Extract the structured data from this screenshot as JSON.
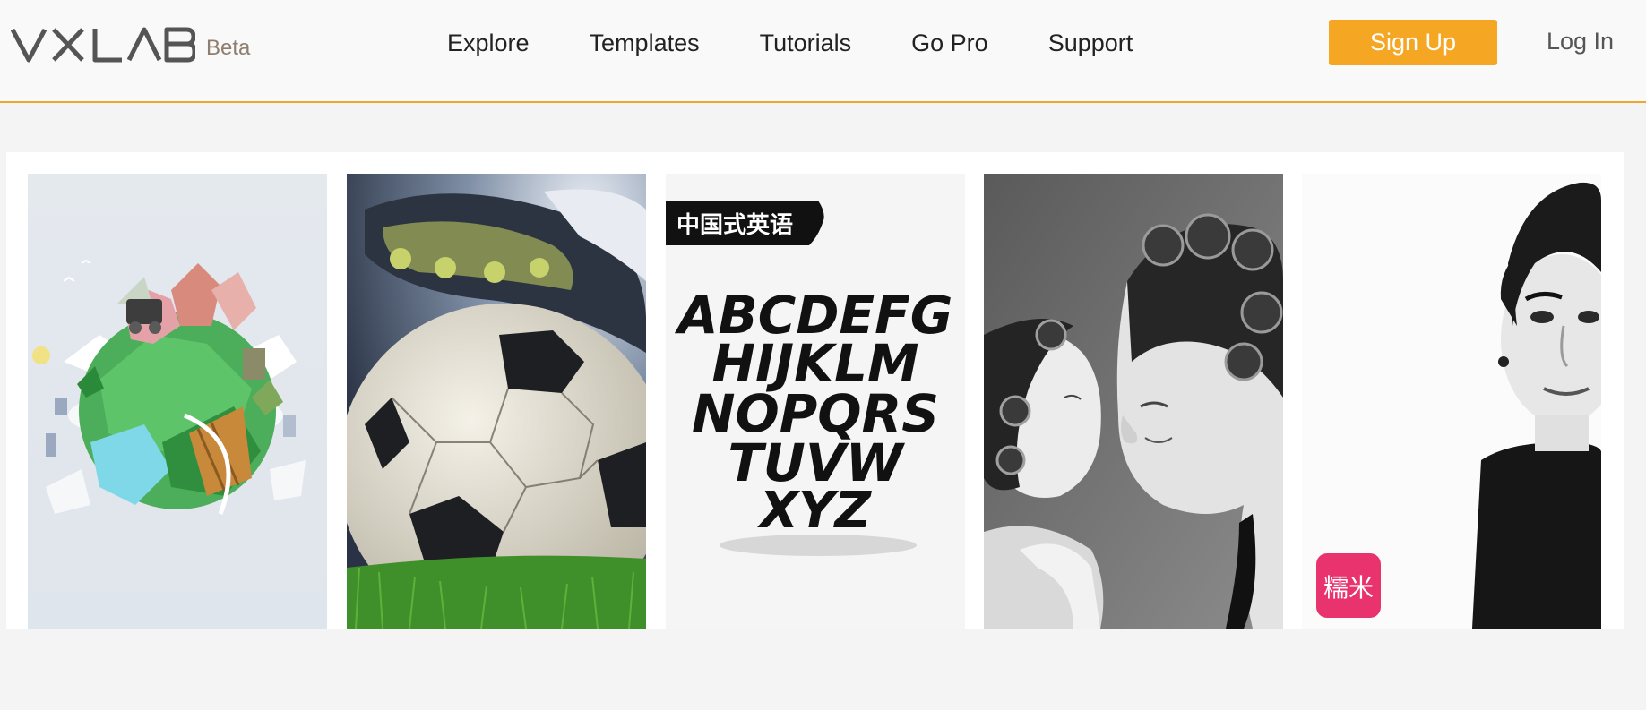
{
  "header": {
    "logo_text": "VXLAB",
    "beta_label": "Beta",
    "nav": [
      "Explore",
      "Templates",
      "Tutorials",
      "Go Pro",
      "Support"
    ],
    "signup_label": "Sign Up",
    "login_label": "Log In"
  },
  "colors": {
    "accent": "#f5a623",
    "header_border": "#f0a52b",
    "logo": "#555555",
    "beta": "#8e7e6e"
  },
  "gallery": {
    "cards": [
      {
        "name": "low-poly-planet-template"
      },
      {
        "name": "soccer-ball-template"
      },
      {
        "name": "brush-alphabet-template",
        "badge_text": "中国式英语",
        "alphabet_lines": [
          "ABCDEFG",
          "HIJKLM",
          "NOPQRS",
          "TUVW",
          "XYZ"
        ]
      },
      {
        "name": "mother-daughter-photo-template"
      },
      {
        "name": "portrait-template",
        "brand_badge": "糯米"
      }
    ]
  }
}
